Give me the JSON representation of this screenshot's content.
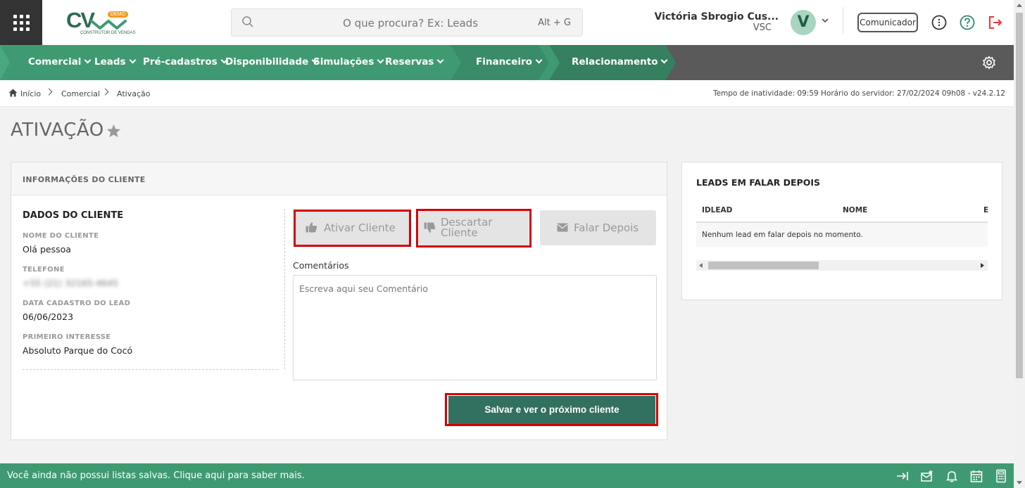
{
  "topbar": {
    "logo_text": "CV",
    "logo_badge": "DEMO",
    "logo_sub": "CONSTRUTOR DE VENDAS",
    "search_placeholder": "O que procura? Ex: Leads",
    "search_shortcut": "Alt + G",
    "user_name": "Victória Sbrogio Cus...",
    "user_sub": "VSC",
    "avatar_letter": "V",
    "comunicador_label": "Comunicador"
  },
  "nav": {
    "items": [
      "Comercial",
      "Leads",
      "Pré-cadastros",
      "Disponibilidade",
      "Simulações",
      "Reservas",
      "Financeiro",
      "Relacionamento"
    ]
  },
  "breadcrumb": {
    "items": [
      "Início",
      "Comercial",
      "Ativação"
    ],
    "status": "Tempo de inatividade: 09:59   Horário do servidor: 27/02/2024 09h08 - v24.2.12"
  },
  "page": {
    "title": "ATIVAÇÃO"
  },
  "client_panel": {
    "header": "INFORMAÇÕES DO CLIENTE",
    "section_title": "DADOS DO CLIENTE",
    "fields": [
      {
        "label": "NOME DO CLIENTE",
        "value": "Olá pessoa"
      },
      {
        "label": "TELEFONE",
        "value": "+55 (21) 32165-4645"
      },
      {
        "label": "DATA CADASTRO DO LEAD",
        "value": "06/06/2023"
      },
      {
        "label": "PRIMEIRO INTERESSE",
        "value": "Absoluto Parque do Cocó"
      }
    ],
    "buttons": {
      "ativar": "Ativar Cliente",
      "descartar_1": "Descartar",
      "descartar_2": "Cliente",
      "falar": "Falar Depois"
    },
    "comments_label": "Comentários",
    "comments_placeholder": "Escreva aqui seu Comentário",
    "save_label": "Salvar e ver o próximo cliente"
  },
  "side_panel": {
    "title": "LEADS EM FALAR DEPOIS",
    "columns": [
      "IDLEAD",
      "NOME",
      "E"
    ],
    "empty_message": "Nenhum lead em falar depois no momento."
  },
  "footer": {
    "text": "Você ainda não possui listas salvas. Clique aqui para saber mais."
  },
  "colors": {
    "brand_green": "#3f9a72",
    "dark_green": "#32705f",
    "highlight_red": "#d40000",
    "logout_red": "#e53935"
  }
}
